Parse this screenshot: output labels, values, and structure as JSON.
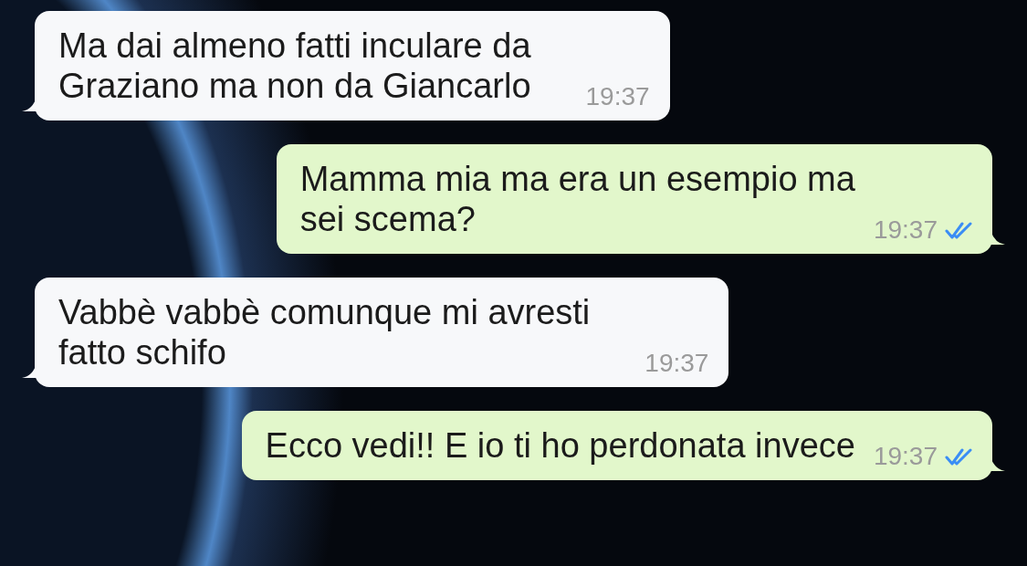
{
  "messages": [
    {
      "kind": "incoming",
      "text": "Ma dai almeno fatti inculare da\nGraziano ma non da Giancarlo",
      "time": "19:37"
    },
    {
      "kind": "outgoing",
      "text": "Mamma mia ma era un esempio ma\nsei scema?",
      "time": "19:37",
      "read": true
    },
    {
      "kind": "incoming",
      "text": "Vabbè vabbè comunque mi avresti\nfatto schifo",
      "time": "19:37"
    },
    {
      "kind": "outgoing",
      "text": "Ecco vedi!! E io ti ho perdonata invece",
      "time": "19:37",
      "read": true
    }
  ]
}
